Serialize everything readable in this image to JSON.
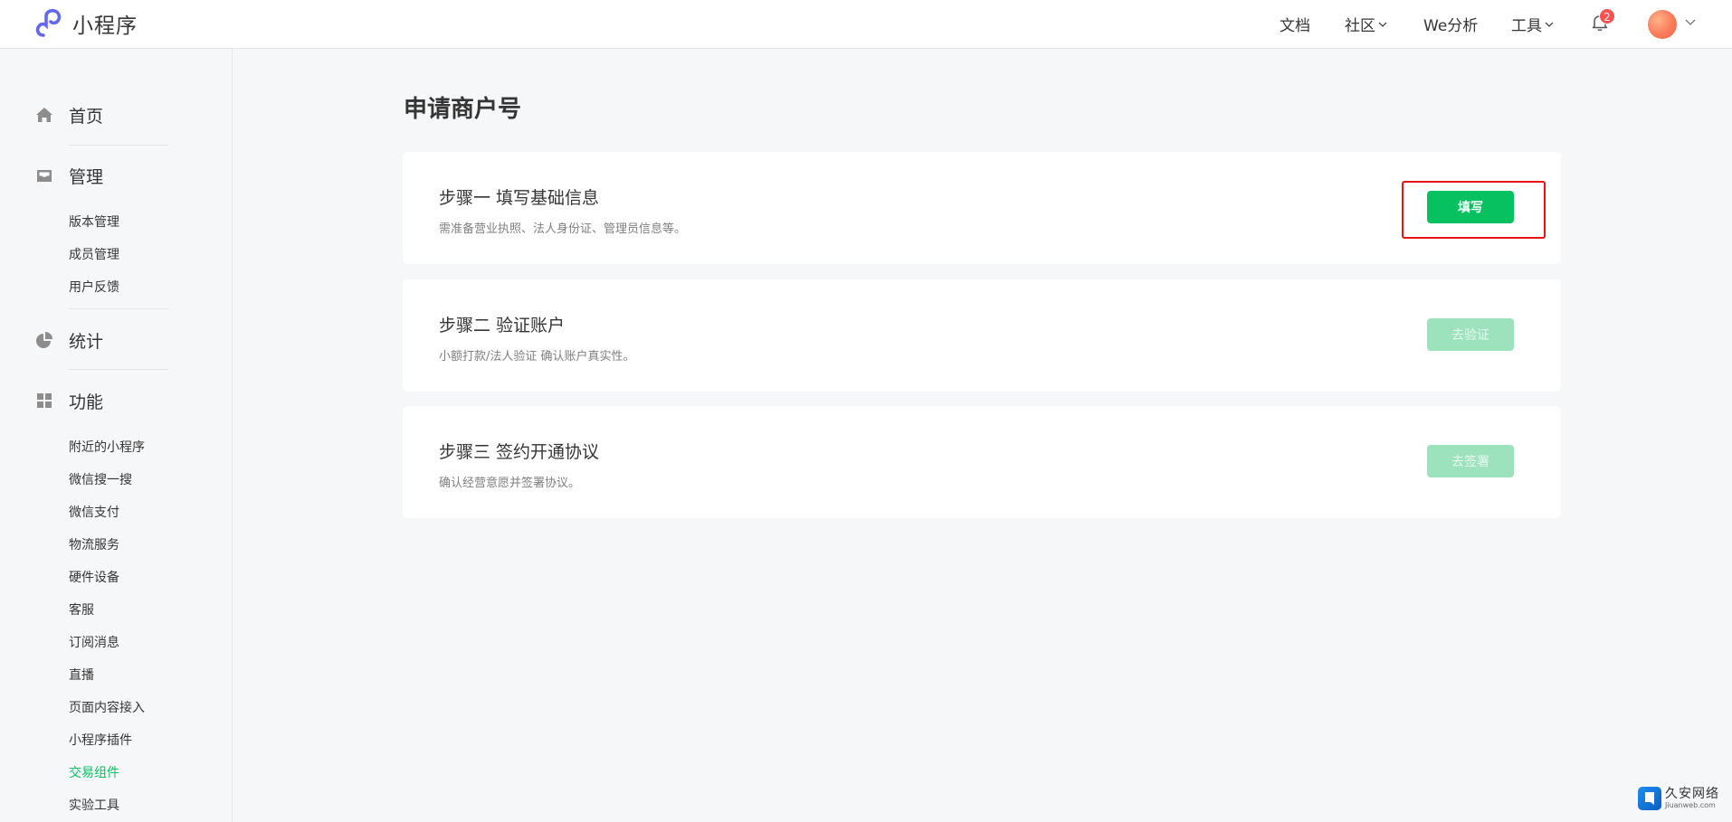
{
  "header": {
    "logo_text": "小程序",
    "nav": {
      "docs": "文档",
      "community": "社区",
      "analytics": "We分析",
      "tools": "工具"
    },
    "notification_count": "2"
  },
  "sidebar": {
    "home": "首页",
    "manage": {
      "label": "管理",
      "items": [
        "版本管理",
        "成员管理",
        "用户反馈"
      ]
    },
    "stats": "统计",
    "features": {
      "label": "功能",
      "items": [
        "附近的小程序",
        "微信搜一搜",
        "微信支付",
        "物流服务",
        "硬件设备",
        "客服",
        "订阅消息",
        "直播",
        "页面内容接入",
        "小程序插件",
        "交易组件",
        "实验工具"
      ],
      "active_item": "交易组件"
    }
  },
  "main": {
    "title": "申请商户号",
    "steps": [
      {
        "title": "步骤一 填写基础信息",
        "desc": "需准备营业执照、法人身份证、管理员信息等。",
        "button": "填写",
        "enabled": true
      },
      {
        "title": "步骤二 验证账户",
        "desc": "小额打款/法人验证 确认账户真实性。",
        "button": "去验证",
        "enabled": false
      },
      {
        "title": "步骤三 签约开通协议",
        "desc": "确认经营意愿并签署协议。",
        "button": "去签署",
        "enabled": false
      }
    ]
  },
  "watermark": {
    "cn": "久安网络",
    "en": "Jiuanweb.com"
  },
  "colors": {
    "accent": "#07c160",
    "accent_disabled": "#9be2bd",
    "highlight": "#e81414",
    "badge": "#fa5151"
  }
}
